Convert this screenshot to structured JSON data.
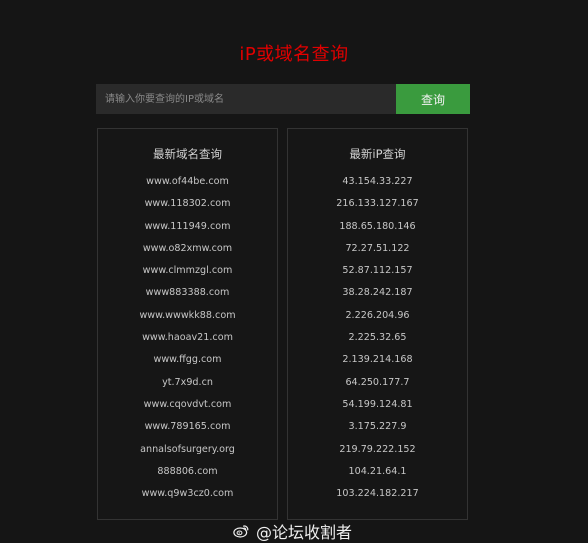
{
  "page": {
    "title": "iP或域名查询"
  },
  "search": {
    "placeholder": "请输入你要查询的IP或域名",
    "button_label": "查询"
  },
  "domains_panel": {
    "header": "最新域名查询",
    "items": [
      "www.of44be.com",
      "www.118302.com",
      "www.111949.com",
      "www.o82xmw.com",
      "www.clmmzgl.com",
      "www883388.com",
      "www.wwwkk88.com",
      "www.haoav21.com",
      "www.ffgg.com",
      "yt.7x9d.cn",
      "www.cqovdvt.com",
      "www.789165.com",
      "annalsofsurgery.org",
      "888806.com",
      "www.q9w3cz0.com"
    ]
  },
  "ips_panel": {
    "header": "最新iP查询",
    "items": [
      "43.154.33.227",
      "216.133.127.167",
      "188.65.180.146",
      "72.27.51.122",
      "52.87.112.157",
      "38.28.242.187",
      "2.226.204.96",
      "2.225.32.65",
      "2.139.214.168",
      "64.250.177.7",
      "54.199.124.81",
      "3.175.227.9",
      "219.79.222.152",
      "104.21.64.1",
      "103.224.182.217"
    ]
  },
  "watermark": {
    "icon": "weibo-icon",
    "text": "@论坛收割者"
  },
  "colors": {
    "title": "#e00000",
    "button": "#3a9b3e",
    "background": "#151515"
  }
}
